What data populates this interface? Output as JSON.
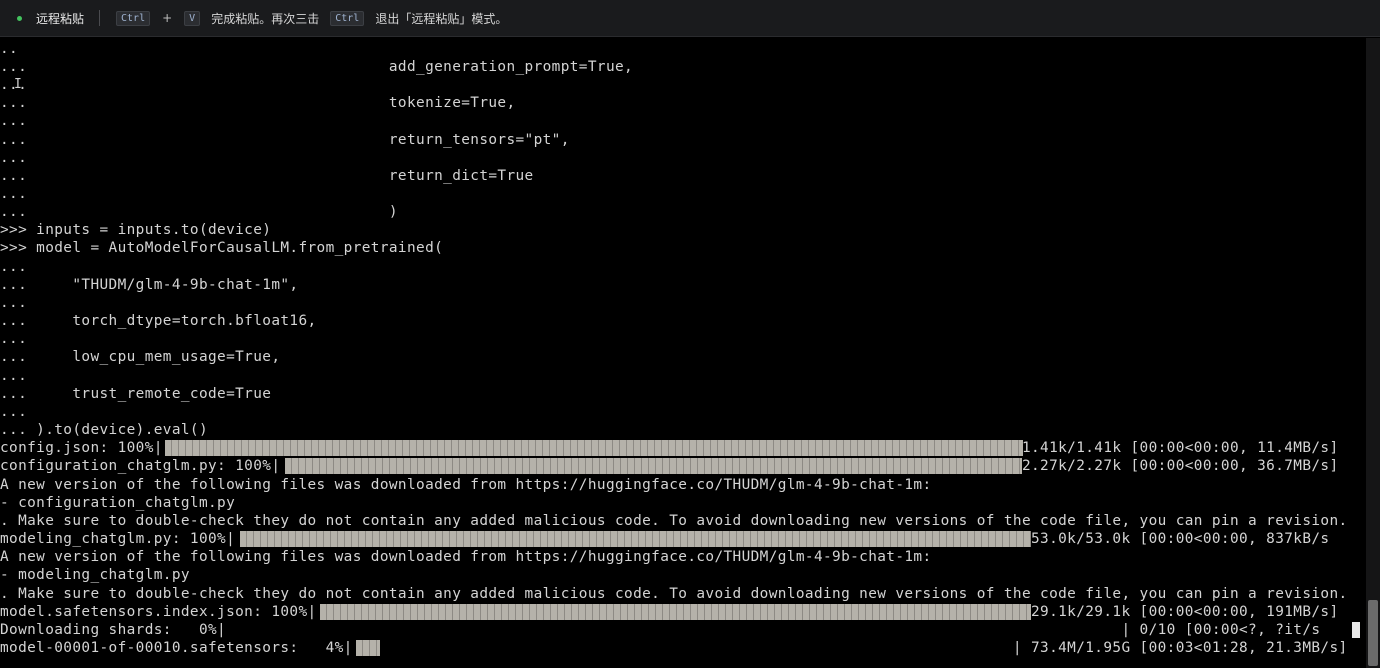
{
  "banner": {
    "title": "远程粘贴",
    "key_ctrl": "Ctrl",
    "plus": "+",
    "key_v": "V",
    "msg_middle": "完成粘贴。再次三击",
    "key_ctrl_2": "Ctrl",
    "msg_end": "退出「远程粘贴」模式。"
  },
  "terminal": {
    "lines": [
      "..",
      "...                                        add_generation_prompt=True,",
      "...",
      "...                                        tokenize=True,",
      "...",
      "...                                        return_tensors=\"pt\",",
      "...",
      "...                                        return_dict=True",
      "...",
      "...                                        )",
      ">>> inputs = inputs.to(device)",
      ">>> model = AutoModelForCausalLM.from_pretrained(",
      "...",
      "...     \"THUDM/glm-4-9b-chat-1m\",",
      "...",
      "...     torch_dtype=torch.bfloat16,",
      "...",
      "...     low_cpu_mem_usage=True,",
      "...",
      "...     trust_remote_code=True",
      "...",
      "... ).to(device).eval()",
      "config.json: 100%|                                                                                             | 1.41k/1.41k [00:00<00:00, 11.4MB/s]",
      "configuration_chatglm.py: 100%|                                                                                | 2.27k/2.27k [00:00<00:00, 36.7MB/s]",
      "A new version of the following files was downloaded from https://huggingface.co/THUDM/glm-4-9b-chat-1m:",
      "- configuration_chatglm.py",
      ". Make sure to double-check they do not contain any added malicious code. To avoid downloading new versions of the code file, you can pin a revision.",
      "modeling_chatglm.py: 100%|                                                                                      | 53.0k/53.0k [00:00<00:00, 837kB/s",
      "A new version of the following files was downloaded from https://huggingface.co/THUDM/glm-4-9b-chat-1m:",
      "- modeling_chatglm.py",
      ". Make sure to double-check they do not contain any added malicious code. To avoid downloading new versions of the code file, you can pin a revision.",
      "model.safetensors.index.json: 100%|                                                                             | 29.1k/29.1k [00:00<00:00, 191MB/s]",
      "Downloading shards:   0%|                                                                                                   | 0/10 [00:00<?, ?it/s",
      "model-00001-of-00010.safetensors:   4%|                                                                         | 73.4M/1.95G [00:03<01:28, 21.3MB/s]"
    ]
  },
  "progress": [
    {
      "name": "config.json",
      "fraction": 1.0
    },
    {
      "name": "configuration_chatglm.py",
      "fraction": 1.0
    },
    {
      "name": "modeling_chatglm.py",
      "fraction": 1.0
    },
    {
      "name": "model.safetensors.index.json",
      "fraction": 1.0
    },
    {
      "name": "Downloading shards",
      "fraction": 0.0
    },
    {
      "name": "model-00001-of-00010.safetensors",
      "fraction": 0.04
    }
  ],
  "colors": {
    "background": "#000000",
    "text": "#d4d4d4",
    "progress_bar": "#b5b2aa",
    "banner_bg": "#1a1b1d",
    "status_dot": "#43c35e"
  }
}
